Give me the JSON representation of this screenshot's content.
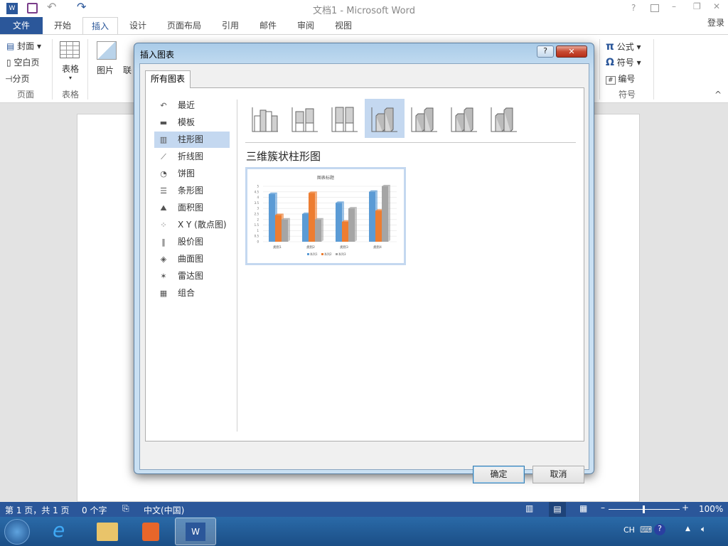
{
  "window": {
    "title": "文档1 - Microsoft Word",
    "help": "?",
    "signin": "登录"
  },
  "tabs": [
    {
      "label": "文件"
    },
    {
      "label": "开始"
    },
    {
      "label": "插入"
    },
    {
      "label": "设计"
    },
    {
      "label": "页面布局"
    },
    {
      "label": "引用"
    },
    {
      "label": "邮件"
    },
    {
      "label": "审阅"
    },
    {
      "label": "视图"
    }
  ],
  "ribbon": {
    "cover": "封面",
    "blank": "空白页",
    "break": "分页",
    "group_pages": "页面",
    "table": "表格",
    "group_table": "表格",
    "picture": "图片",
    "online": "联",
    "equation": "公式",
    "symbol": "符号",
    "number": "编号",
    "group_symbols": "符号"
  },
  "dialog": {
    "title": "插入图表",
    "help": "?",
    "tab": "所有图表",
    "categories": [
      {
        "label": "最近",
        "icon": "↶"
      },
      {
        "label": "模板",
        "icon": "▬"
      },
      {
        "label": "柱形图",
        "icon": "▥"
      },
      {
        "label": "折线图",
        "icon": "⟋"
      },
      {
        "label": "饼图",
        "icon": "◔"
      },
      {
        "label": "条形图",
        "icon": "☰"
      },
      {
        "label": "面积图",
        "icon": "⛰"
      },
      {
        "label": "X Y (散点图)",
        "icon": "⁘"
      },
      {
        "label": "股价图",
        "icon": "‖"
      },
      {
        "label": "曲面图",
        "icon": "◈"
      },
      {
        "label": "雷达图",
        "icon": "✶"
      },
      {
        "label": "组合",
        "icon": "▦"
      }
    ],
    "selected_category": "柱形图",
    "subtype_title": "三维簇状柱形图",
    "ok": "确定",
    "cancel": "取消"
  },
  "chart_data": {
    "type": "bar",
    "title": "图表标题",
    "categories": [
      "类别1",
      "类别2",
      "类别3",
      "类别4"
    ],
    "series": [
      {
        "name": "系列1",
        "values": [
          4.3,
          2.5,
          3.5,
          4.5
        ],
        "color": "#5b9bd5"
      },
      {
        "name": "系列2",
        "values": [
          2.4,
          4.4,
          1.8,
          2.8
        ],
        "color": "#ed7d31"
      },
      {
        "name": "系列3",
        "values": [
          2,
          2,
          3,
          5
        ],
        "color": "#a5a5a5"
      }
    ],
    "ylim": [
      0,
      5
    ],
    "yticks": [
      "0",
      "0.5",
      "1",
      "1.5",
      "2",
      "2.5",
      "3",
      "3.5",
      "4",
      "4.5",
      "5"
    ],
    "grid": true,
    "legend": "bottom"
  },
  "status": {
    "page": "第 1 页，共 1 页",
    "words": "0 个字",
    "lang": "中文(中国)",
    "zoom": "100%",
    "zoom_level": 100
  },
  "taskbar": {
    "ime": "CH"
  }
}
